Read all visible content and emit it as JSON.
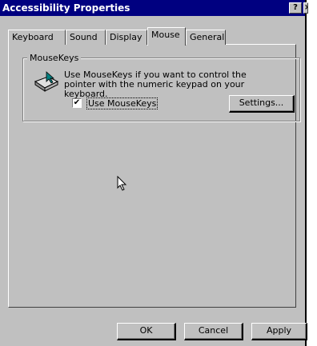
{
  "window": {
    "title": "Accessibility Properties",
    "help_button": "?",
    "close_button": "×"
  },
  "tabs": [
    {
      "label": "Keyboard"
    },
    {
      "label": "Sound"
    },
    {
      "label": "Display"
    },
    {
      "label": "Mouse",
      "active": true
    },
    {
      "label": "General"
    }
  ],
  "mousekeys": {
    "group_title": "MouseKeys",
    "description": "Use MouseKeys if you want to control the pointer with the numeric keypad on your keyboard.",
    "checkbox_label": "Use MouseKeys",
    "checkbox_checked": true,
    "check_mark": "✔",
    "settings_button": "Settings..."
  },
  "footer": {
    "ok_button": "OK",
    "cancel_button": "Cancel",
    "apply_button": "Apply"
  },
  "icons": [
    "mouse-keys-icon",
    "mouse-cursor-icon"
  ]
}
